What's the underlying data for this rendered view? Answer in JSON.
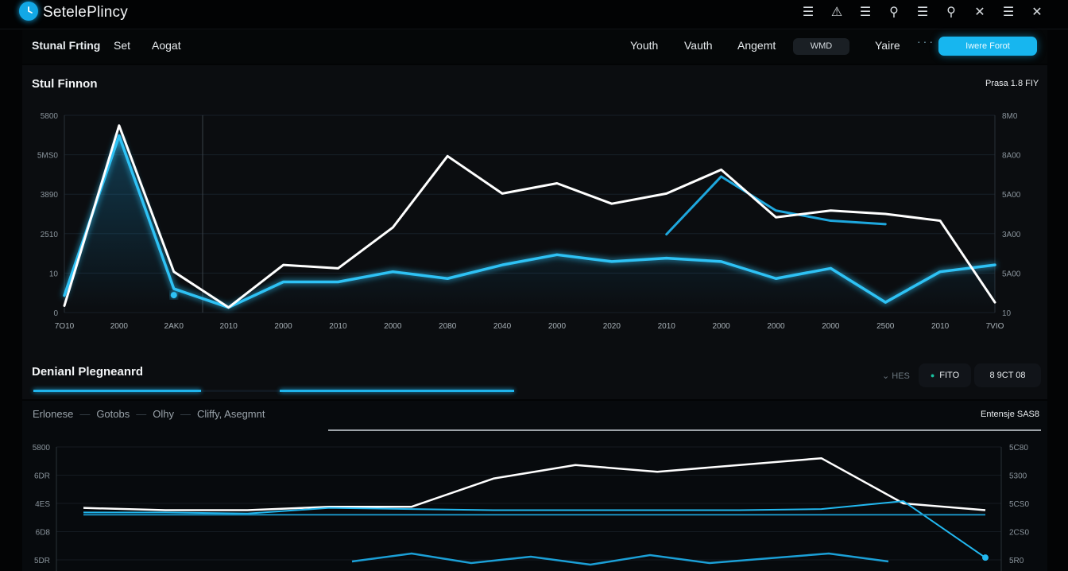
{
  "app": {
    "title": "SetelePlincy"
  },
  "window_icons": [
    "menu-icon",
    "warning-icon",
    "menu-icon",
    "location-pin-icon",
    "menu-icon",
    "location-pin-icon",
    "close-icon",
    "menu-icon",
    "close-icon"
  ],
  "nav": {
    "left": [
      "Stunal Frting",
      "Set",
      "Aogat"
    ],
    "right": [
      "Youth",
      "Vauth",
      "Angemt"
    ],
    "pill": "WMD",
    "after_pill": "Yaire",
    "cta": "Iwere Forot"
  },
  "panel1": {
    "title": "Stul Finnon",
    "tag": "Prasa 1.8 FIY"
  },
  "section2": {
    "title": "Denianl Plegneanrd",
    "progress": [
      0.35,
      0.49
    ],
    "tag": "HES",
    "pill_a": "FITO",
    "pill_b": "8 9CT 08"
  },
  "panel2": {
    "tabs": [
      "Erlonese",
      "Gotobs",
      "Olhy",
      "Cliffy, Asegmnt"
    ],
    "tag": "Entensje SAS8"
  },
  "colors": {
    "accent": "#17b6ef",
    "line_white": "#ffffff",
    "panel": "#0b0d10"
  },
  "chart_data": [
    {
      "type": "line",
      "title": "Stul Finnon",
      "x": [
        "7O10",
        "2000",
        "2AK0",
        "2010",
        "2000",
        "2010",
        "2000",
        "2080",
        "2040",
        "2000",
        "2020",
        "2010",
        "2000",
        "2000",
        "2000",
        "2500",
        "2010",
        "7VIO"
      ],
      "y_left_ticks": [
        "5800",
        "5MS0",
        "3890",
        "2510",
        "10",
        "0"
      ],
      "y_right_ticks": [
        "8M0",
        "8A00",
        "5A00",
        "3A00",
        "5A00",
        "10"
      ],
      "ylim": [
        0,
        5800
      ],
      "series": [
        {
          "values": [
            200,
            5500,
            1200,
            150,
            1400,
            1300,
            2500,
            4600,
            3500,
            3800,
            3200,
            3500,
            4200,
            2800,
            3000,
            2900,
            2700,
            300
          ]
        },
        {
          "values": [
            500,
            5200,
            700,
            150,
            900,
            900,
            1200,
            1000,
            1400,
            1700,
            1500,
            1600,
            1500,
            1000,
            1300,
            300,
            1200,
            1400
          ]
        },
        {
          "values": [
            null,
            null,
            null,
            null,
            null,
            null,
            null,
            null,
            null,
            null,
            null,
            2300,
            4000,
            3000,
            2700,
            2600,
            null,
            null
          ]
        }
      ]
    },
    {
      "type": "line",
      "x_count": 12,
      "y_left_ticks": [
        "5800",
        "6DR",
        "4ES",
        "6D8",
        "5DR"
      ],
      "y_right_ticks": [
        "5C80",
        "5300",
        "5CS0",
        "2CS0",
        "5R0"
      ],
      "series": [
        {
          "values": [
            2.3,
            2.2,
            2.2,
            2.35,
            2.35,
            3.6,
            4.2,
            3.9,
            4.2,
            4.5,
            2.5,
            2.2
          ]
        },
        {
          "values": [
            2.1,
            2.1,
            2.05,
            2.3,
            2.25,
            2.2,
            2.2,
            2.2,
            2.2,
            2.25,
            2.6,
            0.1
          ]
        },
        {
          "values": [
            2.0,
            2.0,
            2.0,
            2.0,
            2.0,
            2.0,
            2.0,
            2.0,
            2.0,
            2.0,
            2.0,
            2.0
          ]
        }
      ]
    }
  ]
}
